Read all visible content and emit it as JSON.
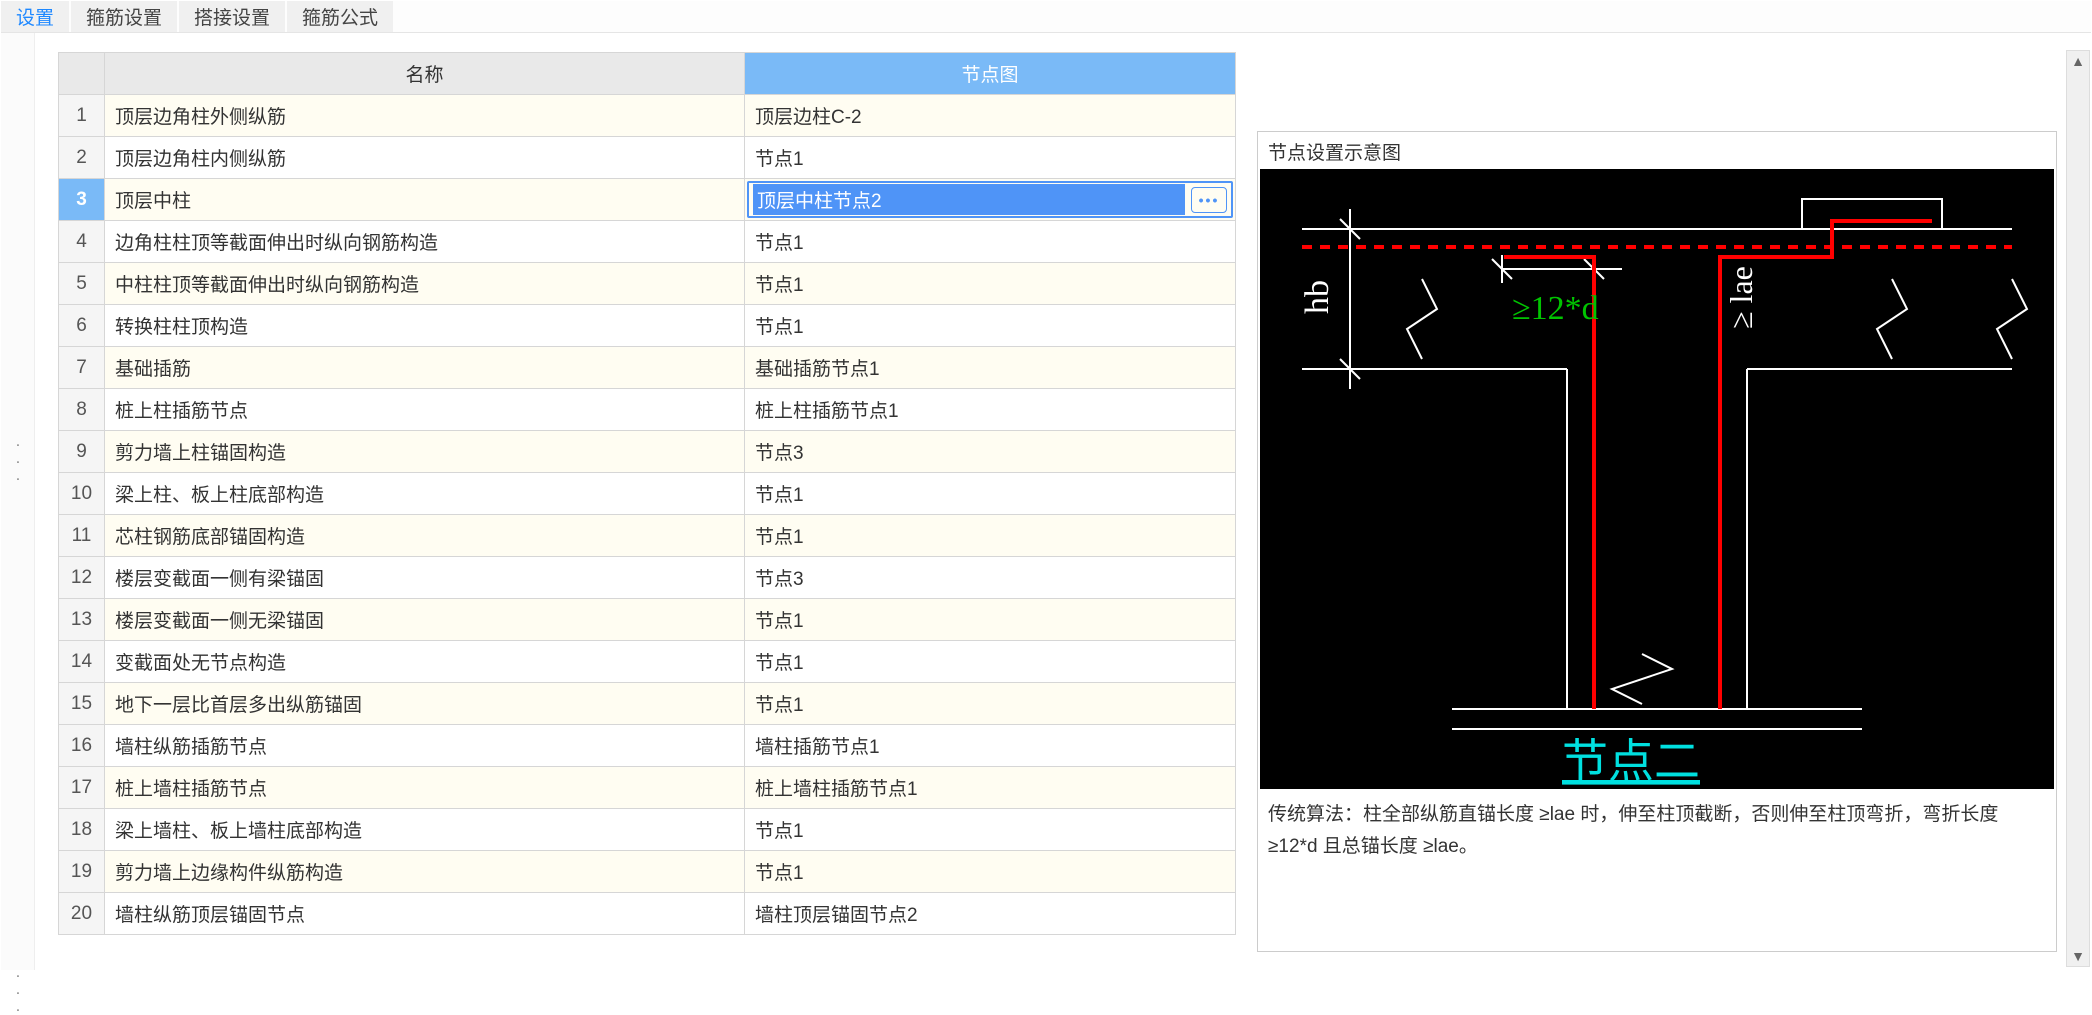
{
  "tabs": {
    "t0_partial": "设置",
    "t1": "箍筋设置",
    "t2": "搭接设置",
    "t3": "箍筋公式"
  },
  "gutter": {
    "dots1": "...",
    "dots2": "..."
  },
  "table": {
    "headers": {
      "name": "名称",
      "node": "节点图"
    },
    "selected_index": 3,
    "selected_value": "顶层中柱节点2",
    "rows": [
      {
        "i": "1",
        "name": "顶层边角柱外侧纵筋",
        "node": "顶层边柱C-2"
      },
      {
        "i": "2",
        "name": "顶层边角柱内侧纵筋",
        "node": "节点1"
      },
      {
        "i": "3",
        "name": "顶层中柱",
        "node": "顶层中柱节点2"
      },
      {
        "i": "4",
        "name": "边角柱柱顶等截面伸出时纵向钢筋构造",
        "node": "节点1"
      },
      {
        "i": "5",
        "name": "中柱柱顶等截面伸出时纵向钢筋构造",
        "node": "节点1"
      },
      {
        "i": "6",
        "name": "转换柱柱顶构造",
        "node": "节点1"
      },
      {
        "i": "7",
        "name": "基础插筋",
        "node": "基础插筋节点1"
      },
      {
        "i": "8",
        "name": "桩上柱插筋节点",
        "node": "桩上柱插筋节点1"
      },
      {
        "i": "9",
        "name": "剪力墙上柱锚固构造",
        "node": "节点3"
      },
      {
        "i": "10",
        "name": "梁上柱、板上柱底部构造",
        "node": "节点1"
      },
      {
        "i": "11",
        "name": "芯柱钢筋底部锚固构造",
        "node": "节点1"
      },
      {
        "i": "12",
        "name": "楼层变截面一侧有梁锚固",
        "node": "节点3"
      },
      {
        "i": "13",
        "name": "楼层变截面一侧无梁锚固",
        "node": "节点1"
      },
      {
        "i": "14",
        "name": "变截面处无节点构造",
        "node": "节点1"
      },
      {
        "i": "15",
        "name": "地下一层比首层多出纵筋锚固",
        "node": "节点1"
      },
      {
        "i": "16",
        "name": "墙柱纵筋插筋节点",
        "node": "墙柱插筋节点1"
      },
      {
        "i": "17",
        "name": "桩上墙柱插筋节点",
        "node": "桩上墙柱插筋节点1"
      },
      {
        "i": "18",
        "name": "梁上墙柱、板上墙柱底部构造",
        "node": "节点1"
      },
      {
        "i": "19",
        "name": "剪力墙上边缘构件纵筋构造",
        "node": "节点1"
      },
      {
        "i": "20",
        "name": "墙柱纵筋顶层锚固节点",
        "node": "墙柱顶层锚固节点2"
      }
    ]
  },
  "diagram": {
    "title": "节点设置示意图",
    "label_hb": "hb",
    "label_lae": "≥ lae",
    "label_12d": "≥12*d",
    "label_node2": "节点二",
    "caption": "传统算法：柱全部纵筋直锚长度 ≥lae 时，伸至柱顶截断，否则伸至柱顶弯折，弯折长度 ≥12*d 且总锚长度 ≥lae。"
  },
  "icons": {
    "more": "•••"
  }
}
